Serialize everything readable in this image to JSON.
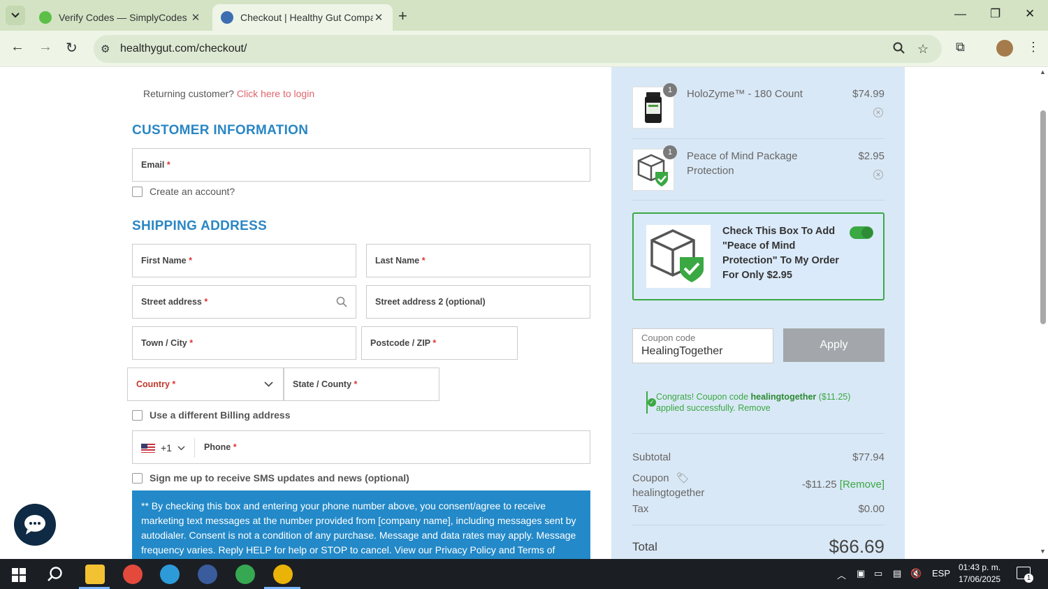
{
  "browser": {
    "tabs": [
      {
        "title": "Verify Codes — SimplyCodes",
        "active": false,
        "favicon_color": "#5bbf48"
      },
      {
        "title": "Checkout | Healthy Gut Compar",
        "active": true,
        "favicon_color": "#3d6fb0"
      }
    ],
    "url": "healthygut.com/checkout/"
  },
  "checkout": {
    "returning_text": "Returning customer?",
    "login_link": "Click here to login",
    "customer_title": "CUSTOMER INFORMATION",
    "email_label": "Email",
    "create_account": "Create an account?",
    "shipping_title": "SHIPPING ADDRESS",
    "first_name": "First Name",
    "last_name": "Last Name",
    "street": "Street address",
    "street2": "Street address 2 (optional)",
    "city": "Town / City",
    "postcode": "Postcode / ZIP",
    "country": "Country",
    "state": "State / County",
    "billing": "Use a different Billing address",
    "dial_code": "+1",
    "phone": "Phone",
    "sms": "Sign me up to receive SMS updates and news (optional)",
    "consent": "** By checking this box and entering your phone number above, you consent/agree to receive marketing text messages at the number provided from [company name], including messages sent by autodialer. Consent is not a condition of any purchase. Message and data rates may apply. Message frequency varies. Reply HELP for help or STOP to cancel. View our Privacy Policy and Terms of Service.",
    "required_mark": "*"
  },
  "cart": {
    "items": [
      {
        "name": "HoloZyme™ - 180 Count",
        "price": "$74.99",
        "qty": "1"
      },
      {
        "name": "Peace of Mind Package Protection",
        "price": "$2.95",
        "qty": "1"
      }
    ],
    "protection_text": "Check This Box To Add \"Peace of Mind Protection\" To My Order For Only $2.95",
    "coupon_placeholder": "Coupon code",
    "coupon_value": "HealingTogether",
    "apply_label": "Apply",
    "coupon_msg_prefix": "Congrats! Coupon code",
    "coupon_code": "healingtogether",
    "coupon_msg_amount": "($11.25)",
    "coupon_msg_suffix": "applied successfully.",
    "coupon_msg_remove": "Remove",
    "subtotal_label": "Subtotal",
    "subtotal_value": "$77.94",
    "coupon_label": "Coupon",
    "coupon_name": "healingtogether",
    "coupon_discount": "-$11.25",
    "coupon_remove": "[Remove]",
    "tax_label": "Tax",
    "tax_value": "$0.00",
    "total_label": "Total",
    "total_value": "$66.69"
  },
  "taskbar": {
    "language": "ESP",
    "time": "01:43 p. m.",
    "date": "17/06/2025",
    "notification_count": "1"
  },
  "colors": {
    "accent_blue": "#2a86c4",
    "success_green": "#3aa843",
    "link_red": "#e0636b"
  }
}
